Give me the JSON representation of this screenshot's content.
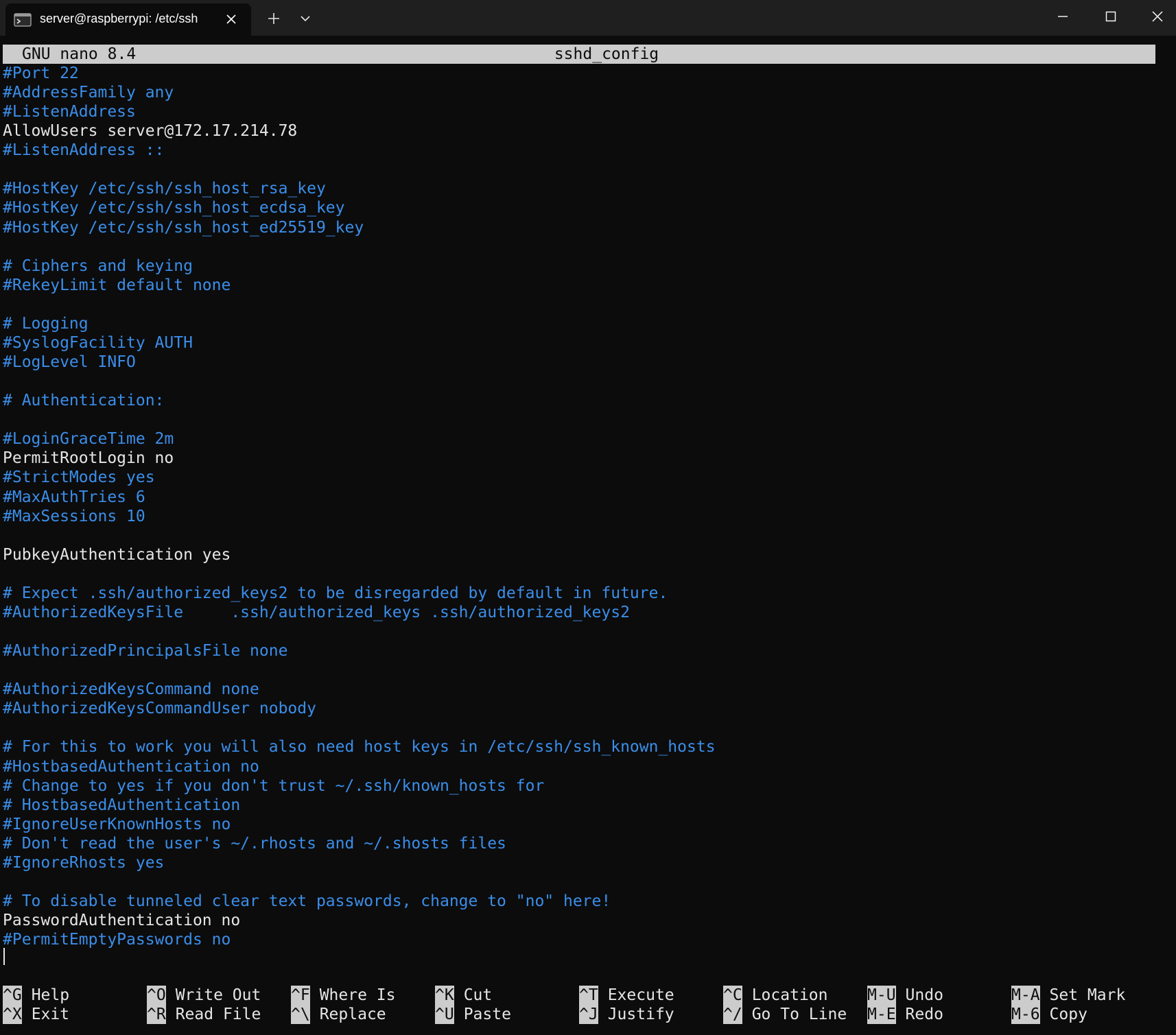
{
  "window": {
    "tab_title": "server@raspberrypi: /etc/ssh"
  },
  "nano": {
    "version": "GNU nano 8.4",
    "filename": "sshd_config"
  },
  "lines": [
    {
      "text": "#Port 22",
      "type": "comment"
    },
    {
      "text": "#AddressFamily any",
      "type": "comment"
    },
    {
      "text": "#ListenAddress",
      "type": "comment"
    },
    {
      "text": "AllowUsers server@172.17.214.78",
      "type": "plain"
    },
    {
      "text": "#ListenAddress ::",
      "type": "comment"
    },
    {
      "text": "",
      "type": "plain"
    },
    {
      "text": "#HostKey /etc/ssh/ssh_host_rsa_key",
      "type": "comment"
    },
    {
      "text": "#HostKey /etc/ssh/ssh_host_ecdsa_key",
      "type": "comment"
    },
    {
      "text": "#HostKey /etc/ssh/ssh_host_ed25519_key",
      "type": "comment"
    },
    {
      "text": "",
      "type": "plain"
    },
    {
      "text": "# Ciphers and keying",
      "type": "comment"
    },
    {
      "text": "#RekeyLimit default none",
      "type": "comment"
    },
    {
      "text": "",
      "type": "plain"
    },
    {
      "text": "# Logging",
      "type": "comment"
    },
    {
      "text": "#SyslogFacility AUTH",
      "type": "comment"
    },
    {
      "text": "#LogLevel INFO",
      "type": "comment"
    },
    {
      "text": "",
      "type": "plain"
    },
    {
      "text": "# Authentication:",
      "type": "comment"
    },
    {
      "text": "",
      "type": "plain"
    },
    {
      "text": "#LoginGraceTime 2m",
      "type": "comment"
    },
    {
      "text": "PermitRootLogin no",
      "type": "plain"
    },
    {
      "text": "#StrictModes yes",
      "type": "comment"
    },
    {
      "text": "#MaxAuthTries 6",
      "type": "comment"
    },
    {
      "text": "#MaxSessions 10",
      "type": "comment"
    },
    {
      "text": "",
      "type": "plain"
    },
    {
      "text": "PubkeyAuthentication yes",
      "type": "plain"
    },
    {
      "text": "",
      "type": "plain"
    },
    {
      "text": "# Expect .ssh/authorized_keys2 to be disregarded by default in future.",
      "type": "comment"
    },
    {
      "text": "#AuthorizedKeysFile     .ssh/authorized_keys .ssh/authorized_keys2",
      "type": "comment"
    },
    {
      "text": "",
      "type": "plain"
    },
    {
      "text": "#AuthorizedPrincipalsFile none",
      "type": "comment"
    },
    {
      "text": "",
      "type": "plain"
    },
    {
      "text": "#AuthorizedKeysCommand none",
      "type": "comment"
    },
    {
      "text": "#AuthorizedKeysCommandUser nobody",
      "type": "comment"
    },
    {
      "text": "",
      "type": "plain"
    },
    {
      "text": "# For this to work you will also need host keys in /etc/ssh/ssh_known_hosts",
      "type": "comment"
    },
    {
      "text": "#HostbasedAuthentication no",
      "type": "comment"
    },
    {
      "text": "# Change to yes if you don't trust ~/.ssh/known_hosts for",
      "type": "comment"
    },
    {
      "text": "# HostbasedAuthentication",
      "type": "comment"
    },
    {
      "text": "#IgnoreUserKnownHosts no",
      "type": "comment"
    },
    {
      "text": "# Don't read the user's ~/.rhosts and ~/.shosts files",
      "type": "comment"
    },
    {
      "text": "#IgnoreRhosts yes",
      "type": "comment"
    },
    {
      "text": "",
      "type": "plain"
    },
    {
      "text": "# To disable tunneled clear text passwords, change to \"no\" here!",
      "type": "comment"
    },
    {
      "text": "PasswordAuthentication no",
      "type": "plain"
    },
    {
      "text": "#PermitEmptyPasswords no",
      "type": "comment"
    }
  ],
  "shortcuts": [
    [
      {
        "key": "^G",
        "label": "Help"
      },
      {
        "key": "^O",
        "label": "Write Out"
      },
      {
        "key": "^F",
        "label": "Where Is"
      },
      {
        "key": "^K",
        "label": "Cut"
      },
      {
        "key": "^T",
        "label": "Execute"
      },
      {
        "key": "^C",
        "label": "Location"
      },
      {
        "key": "M-U",
        "label": "Undo"
      },
      {
        "key": "M-A",
        "label": "Set Mark"
      }
    ],
    [
      {
        "key": "^X",
        "label": "Exit"
      },
      {
        "key": "^R",
        "label": "Read File"
      },
      {
        "key": "^\\",
        "label": "Replace"
      },
      {
        "key": "^U",
        "label": "Paste"
      },
      {
        "key": "^J",
        "label": "Justify"
      },
      {
        "key": "^/",
        "label": "Go To Line"
      },
      {
        "key": "M-E",
        "label": "Redo"
      },
      {
        "key": "M-6",
        "label": "Copy"
      }
    ]
  ]
}
